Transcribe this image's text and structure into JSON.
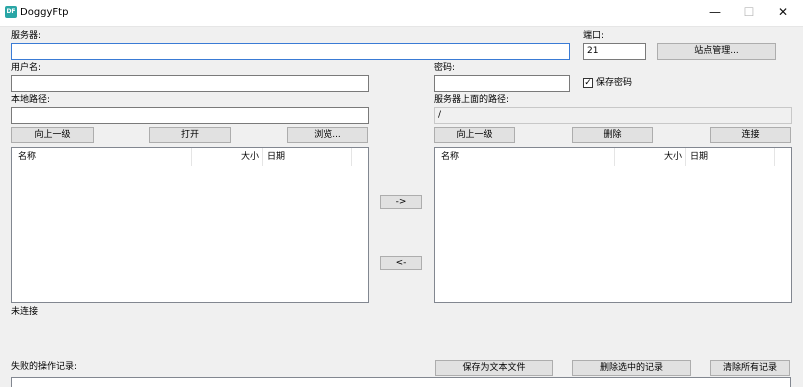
{
  "window": {
    "title": "DoggyFtp",
    "icon_text": "DF",
    "minimize": "—",
    "maximize": "☐",
    "close": "✕"
  },
  "server": {
    "label": "服务器:",
    "value": ""
  },
  "port": {
    "label": "端口:",
    "value": "21"
  },
  "site_manager_button": "站点管理...",
  "username": {
    "label": "用户名:",
    "value": ""
  },
  "password": {
    "label": "密码:",
    "value": ""
  },
  "save_password": {
    "label": "保存密码",
    "checked": true,
    "mark": "✓"
  },
  "local_path": {
    "label": "本地路径:",
    "value": ""
  },
  "remote_path": {
    "label": "服务器上面的路径:",
    "value": "/"
  },
  "local_buttons": {
    "up": "向上一级",
    "open": "打开",
    "browse": "浏览..."
  },
  "remote_buttons": {
    "up": "向上一级",
    "delete": "删除",
    "connect": "连接"
  },
  "local_list": {
    "columns": [
      "名称",
      "大小",
      "日期"
    ]
  },
  "remote_list": {
    "columns": [
      "名称",
      "大小",
      "日期"
    ]
  },
  "transfer": {
    "upload": "->",
    "download": "<-"
  },
  "status": "未连接",
  "failed_log": {
    "label": "失败的操作记录:"
  },
  "log_buttons": {
    "save_text": "保存为文本文件",
    "delete_selected": "删除选中的记录",
    "clear_all": "清除所有记录"
  }
}
